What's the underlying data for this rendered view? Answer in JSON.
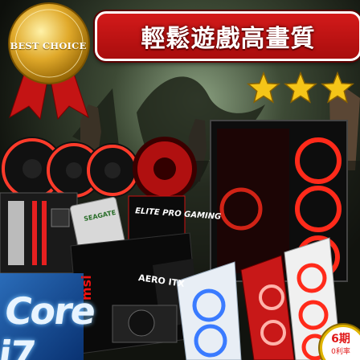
{
  "medal": {
    "label": "BEST CHOICE",
    "gold": "#d9a520",
    "ribbon": "#c41414"
  },
  "banner": {
    "title": "輕鬆遊戲高畫質",
    "color": "#c71212"
  },
  "stars": {
    "count": 3,
    "color": "#f5c518"
  },
  "products": {
    "cpu_box_text": "Core i7",
    "gpu_brand": "msi",
    "gpu_model": "AERO ITX",
    "ram_box_text": "ELITE PRO GAMING",
    "hdd_brand": "SEAGATE"
  },
  "installment_badge": {
    "period": "6期",
    "note": "0利率"
  },
  "colors": {
    "case_glow": "#ff2a1a",
    "fan_ring": "#ff3b2a",
    "blue_case": "#3a7bff"
  }
}
